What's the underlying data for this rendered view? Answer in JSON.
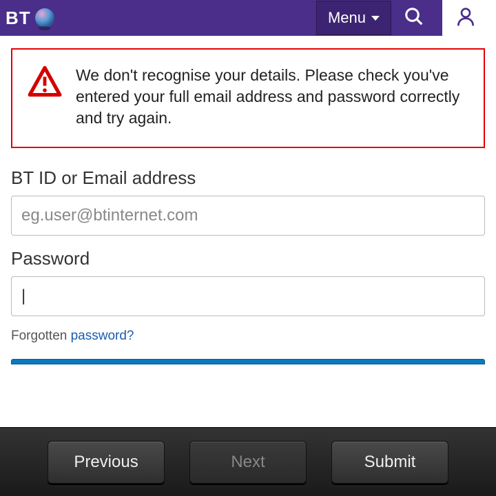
{
  "header": {
    "logo_text": "BT",
    "menu_label": "Menu"
  },
  "error": {
    "message": "We don't recognise your details. Please check you've entered your full email address and password correctly and try again."
  },
  "form": {
    "id_label": "BT ID or Email address",
    "id_placeholder": "eg.user@btinternet.com",
    "password_label": "Password",
    "password_value": "",
    "forgotten_prefix": "Forgotten ",
    "forgotten_link": "password?"
  },
  "toolbar": {
    "previous": "Previous",
    "next": "Next",
    "submit": "Submit"
  }
}
